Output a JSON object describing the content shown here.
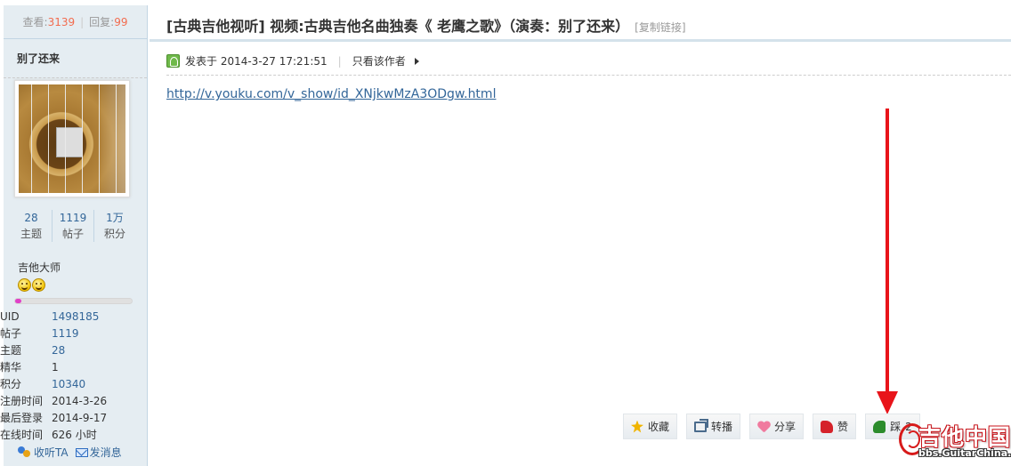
{
  "sidebar": {
    "views_label": "查看:",
    "views": "3139",
    "replies_label": "回复:",
    "replies": "99",
    "author": "别了还来",
    "counts": [
      {
        "value": "28",
        "label": "主题"
      },
      {
        "value": "1119",
        "label": "帖子"
      },
      {
        "value": "1万",
        "label": "积分"
      }
    ],
    "usergroup": "吉他大师",
    "level_progress": 0.05,
    "info": [
      {
        "key": "UID",
        "value": "1498185"
      },
      {
        "key": "帖子",
        "value": "1119"
      },
      {
        "key": "主题",
        "value": "28"
      },
      {
        "key": "精华",
        "value": "1"
      },
      {
        "key": "积分",
        "value": "10340"
      },
      {
        "key": "注册时间",
        "value": "2014-3-26"
      },
      {
        "key": "最后登录",
        "value": "2014-9-17"
      },
      {
        "key": "在线时间",
        "value": "626 小时"
      }
    ],
    "follow_label": "收听TA",
    "message_label": "发消息"
  },
  "post": {
    "title": "[古典吉他视听] 视频:古典吉他名曲独奏《 老鹰之歌》（演奏：别了还来）",
    "copy_link": "[复制链接]",
    "posted_at": "发表于 2014-3-27 17:21:51",
    "author_only": "只看该作者",
    "link": "http://v.youku.com/v_show/id_XNjkwMzA3ODgw.html"
  },
  "buttons": {
    "favorite": "收藏",
    "repost": "转播",
    "share": "分享",
    "like": "赞",
    "dislike": "踩",
    "dislike_count": "2"
  },
  "watermark": {
    "brand": "吉他中国",
    "url": "bbs.GuitarChina.com"
  },
  "colors": {
    "accent_red": "#e8141a",
    "link_blue": "#336699",
    "sidebar_bg": "#e5edf2"
  }
}
